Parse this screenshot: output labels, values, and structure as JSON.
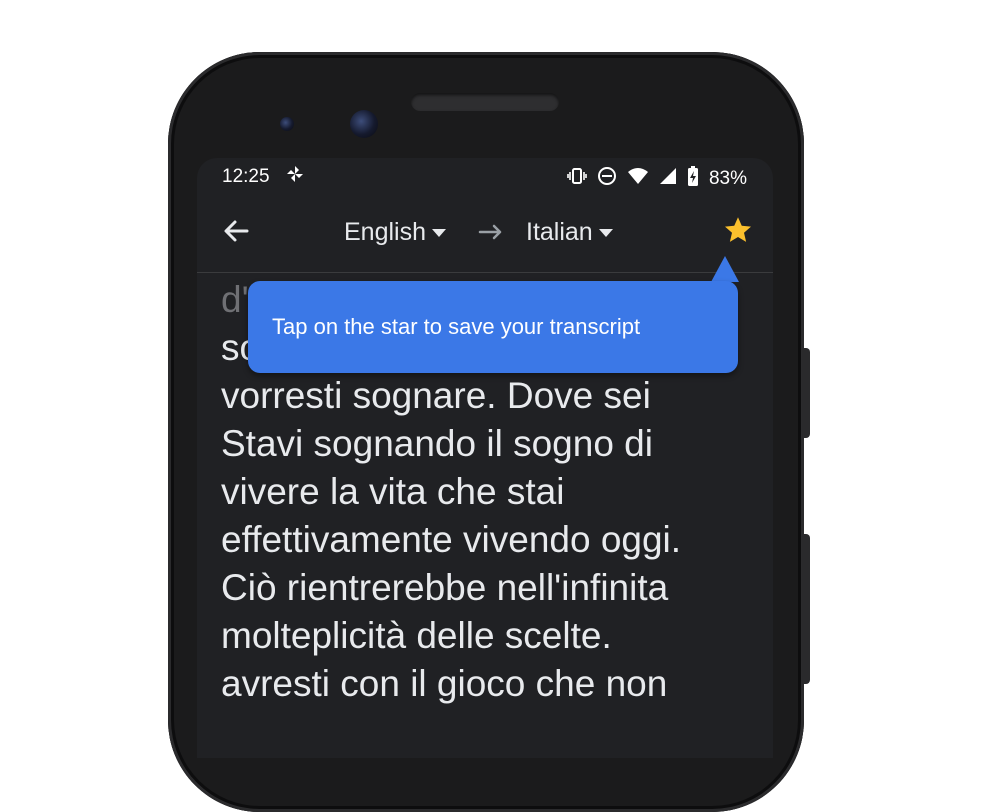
{
  "status_bar": {
    "time": "12:25",
    "battery": "83%",
    "icons": [
      "pinwheel-icon",
      "vibrate-icon",
      "do-not-disturb-icon",
      "wifi-icon",
      "signal-icon",
      "battery-icon"
    ]
  },
  "toolbar": {
    "source_language": "English",
    "target_language": "Italian",
    "back_icon": "arrow-left-icon",
    "swap_icon": "arrow-right-icon",
    "star_icon": "star-icon"
  },
  "tooltip": {
    "text": "Tap on the star to save your transcript"
  },
  "transcript": {
    "lines": [
      "d'",
      "so",
      "vorresti sognare. Dove sei",
      "Stavi sognando il sogno di",
      "vivere la vita che stai",
      "effettivamente vivendo oggi.",
      "Ciò rientrerebbe nell'infinita",
      "molteplicità delle scelte.",
      "avresti con il gioco che non"
    ]
  },
  "colors": {
    "screen_bg": "#202124",
    "tooltip_bg": "#3b78e7",
    "star": "#fbc02d",
    "text": "#e8eaed"
  }
}
